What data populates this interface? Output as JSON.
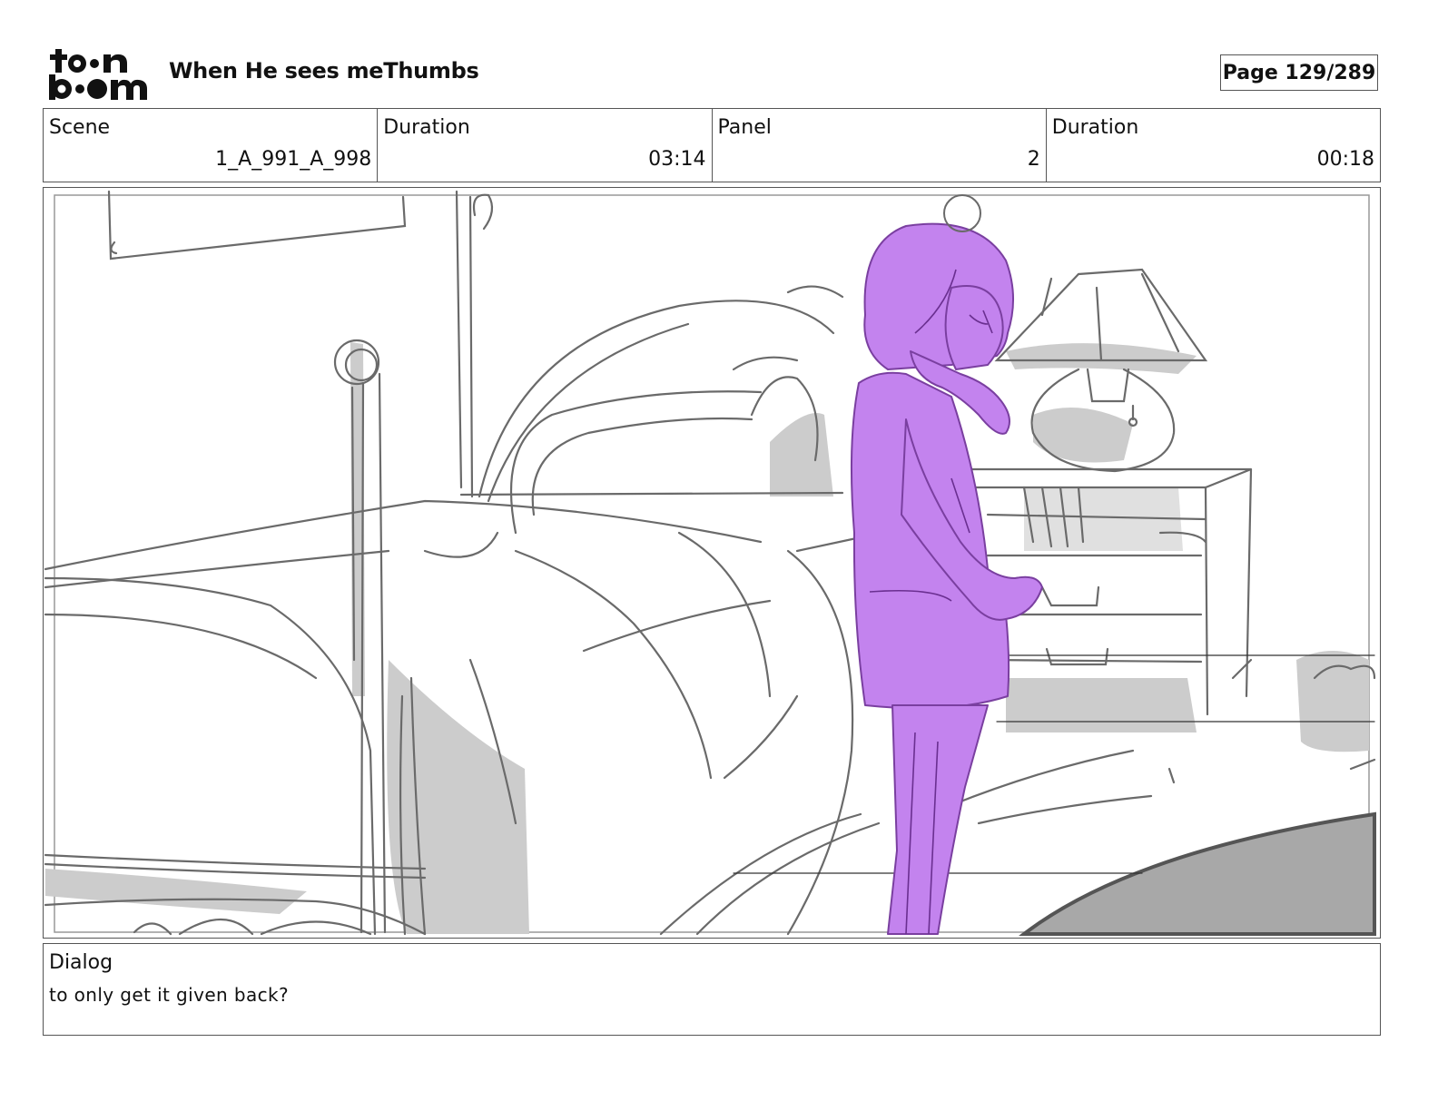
{
  "header": {
    "logo_name": "toonboom-logo",
    "title": "When He sees meThumbs",
    "page": "Page 129/289"
  },
  "info": {
    "scene_label": "Scene",
    "scene_value": "1_A_991_A_998",
    "scene_duration_label": "Duration",
    "scene_duration_value": "03:14",
    "panel_label": "Panel",
    "panel_value": "2",
    "panel_duration_label": "Duration",
    "panel_duration_value": "00:18"
  },
  "panel": {
    "character_color": "#c383ee",
    "sketch_color": "#6a6a6a",
    "shadow_color": "#cccccc",
    "rug_color": "#a8a8a8"
  },
  "dialog": {
    "label": "Dialog",
    "text": "to only get it given back?"
  }
}
